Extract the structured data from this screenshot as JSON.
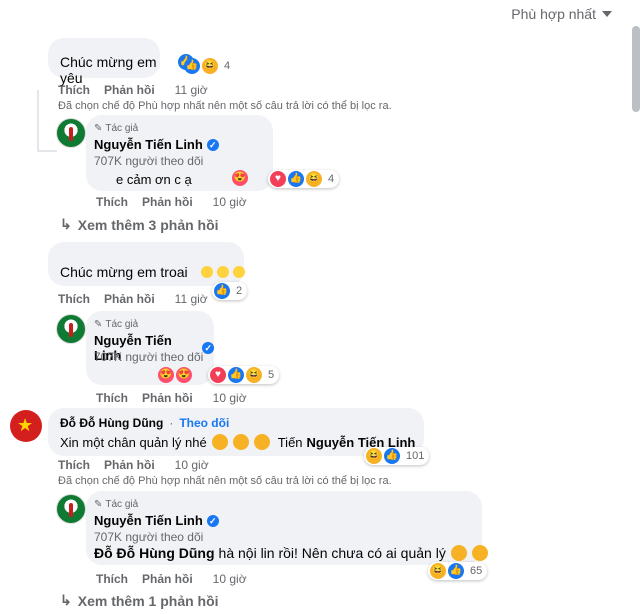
{
  "sort": {
    "label": "Phù hợp nhất"
  },
  "c1": {
    "text": "Chúc mừng em yêu",
    "reactions": "4",
    "like": "Thích",
    "reply": "Phản hồi",
    "time": "11 giờ"
  },
  "note1": "Đã chọn chế độ Phù hợp nhất nên một số câu trả lời có thể bị lọc ra.",
  "r1": {
    "badge": "Tác giả",
    "name": "Nguyễn Tiến Linh",
    "followers": "707K người theo dõi",
    "text": "e cảm ơn c ạ",
    "reactions": "4",
    "like": "Thích",
    "reply": "Phản hồi",
    "time": "10 giờ"
  },
  "more1": "Xem thêm 3 phản hồi",
  "c2": {
    "text": "Chúc mừng em troai",
    "reactions": "2",
    "like": "Thích",
    "reply": "Phản hồi",
    "time": "11 giờ"
  },
  "r2": {
    "badge": "Tác giả",
    "name": "Nguyễn Tiến Linh",
    "followers": "707K người theo dõi",
    "reactions": "5",
    "like": "Thích",
    "reply": "Phản hồi",
    "time": "10 giờ"
  },
  "c3": {
    "name": "Đỗ Đỗ Hùng Dũng",
    "follow": "Theo dõi",
    "text_before": "Xin một chân quản lý nhé",
    "text_tag_prefix": "Tiến",
    "tag": "Nguyễn Tiến Linh",
    "reactions": "101",
    "like": "Thích",
    "reply": "Phản hồi",
    "time": "10 giờ"
  },
  "note2": "Đã chọn chế độ Phù hợp nhất nên một số câu trả lời có thể bị lọc ra.",
  "r3": {
    "badge": "Tác giả",
    "name": "Nguyễn Tiến Linh",
    "followers": "707K người theo dõi",
    "tag": "Đỗ Đỗ Hùng Dũng",
    "text": "hà nội lin rồi! Nên chưa có ai quản lý",
    "reactions": "65",
    "like": "Thích",
    "reply": "Phản hồi",
    "time": "10 giờ"
  },
  "more2": "Xem thêm 1 phản hồi",
  "icons": [
    "caret-down-icon",
    "pen-icon",
    "verified-icon",
    "like-icon",
    "love-icon",
    "haha-icon",
    "reply-arrow-icon"
  ],
  "colors": {
    "accent": "#1877f2",
    "bubble": "#f0f2f5",
    "muted": "#65676b"
  }
}
